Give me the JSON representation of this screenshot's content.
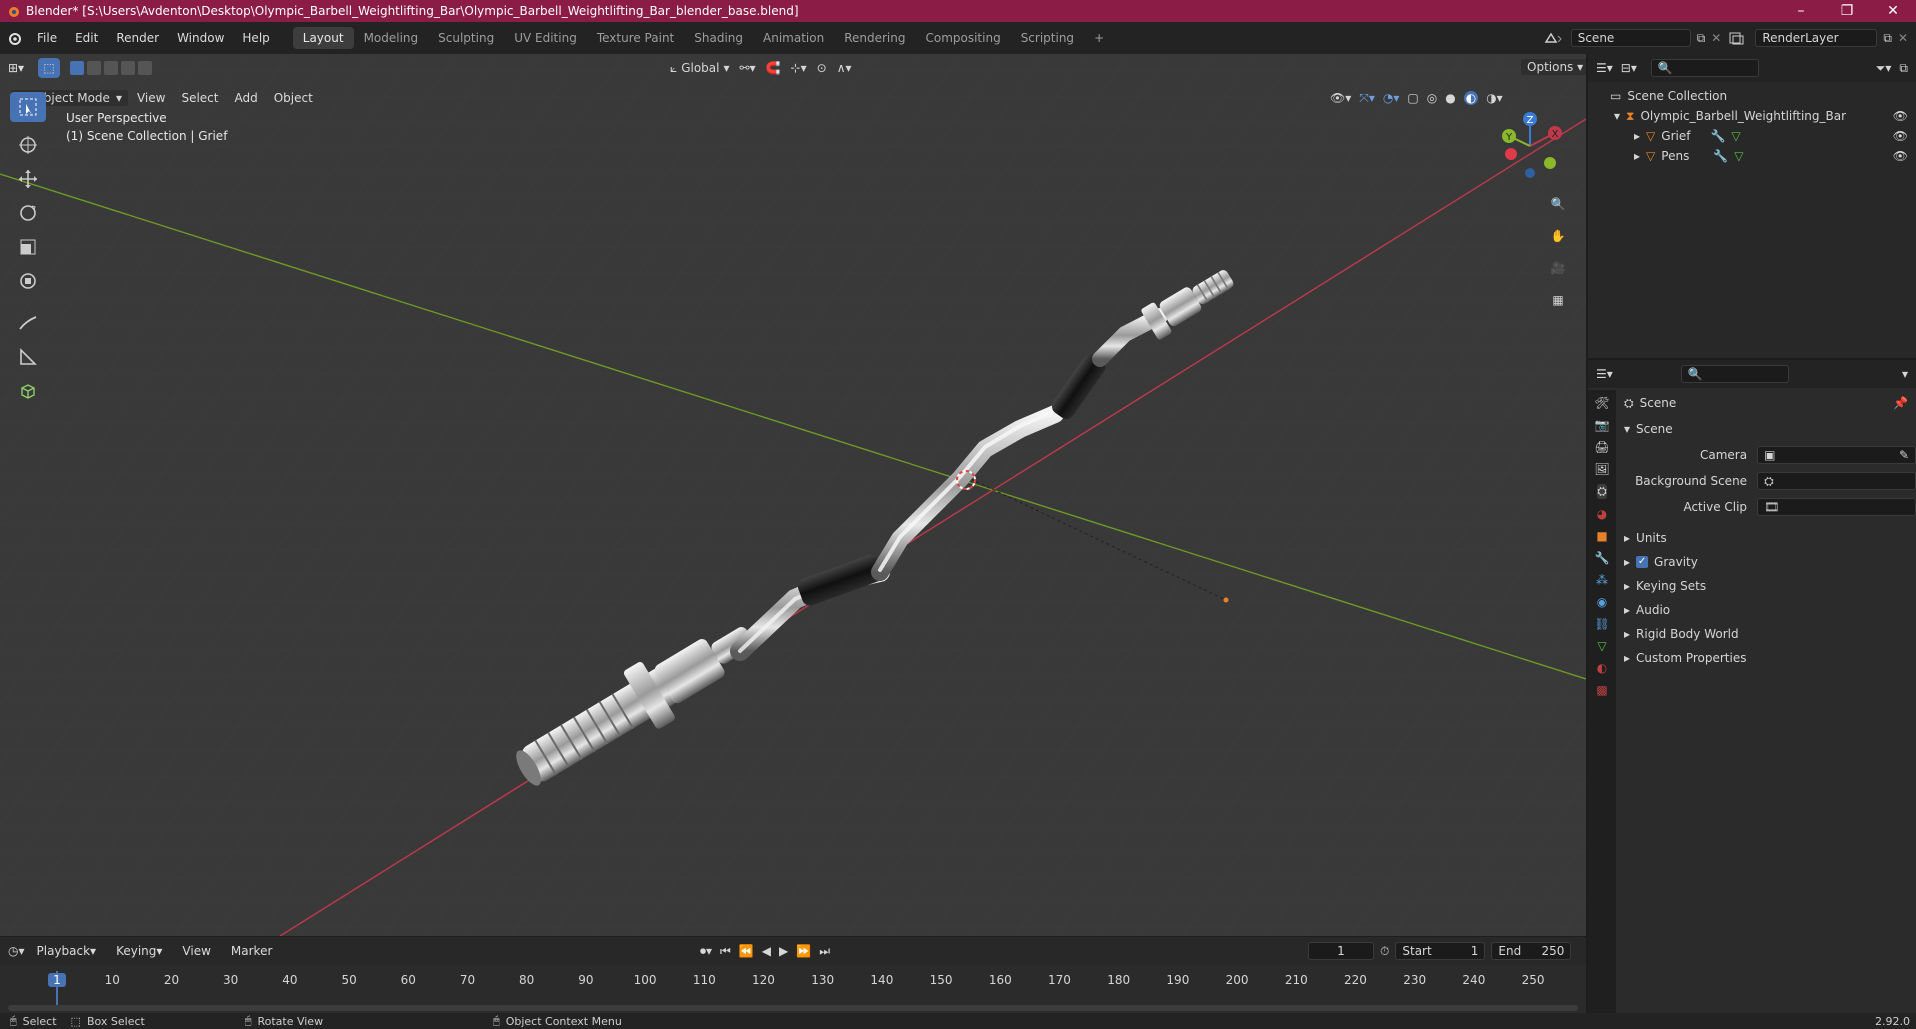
{
  "window": {
    "title": "Blender* [S:\\Users\\Avdenton\\Desktop\\Olympic_Barbell_Weightlifting_Bar\\Olympic_Barbell_Weightlifting_Bar_blender_base.blend]",
    "controls": [
      "–",
      "❐",
      "✕"
    ]
  },
  "menu": [
    "File",
    "Edit",
    "Render",
    "Window",
    "Help"
  ],
  "workspaces": [
    "Layout",
    "Modeling",
    "Sculpting",
    "UV Editing",
    "Texture Paint",
    "Shading",
    "Animation",
    "Rendering",
    "Compositing",
    "Scripting"
  ],
  "active_workspace": "Layout",
  "scene_field": "Scene",
  "renderlayer_field": "RenderLayer",
  "viewport": {
    "transform_orientation": "Global",
    "options_label": "Options",
    "mode": "Object Mode",
    "header_menus": [
      "View",
      "Select",
      "Add",
      "Object"
    ],
    "overlay_title": "User Perspective",
    "overlay_subtitle": "(1) Scene Collection | Grief",
    "gizmo_axes": {
      "z": "Z",
      "y": "Y",
      "x": "X"
    }
  },
  "outliner": {
    "root": "Scene Collection",
    "collection": "Olympic_Barbell_Weightlifting_Bar",
    "objects": [
      "Grief",
      "Pens"
    ]
  },
  "properties": {
    "context": "Scene",
    "section": "Scene",
    "fields": [
      {
        "label": "Camera",
        "value": ""
      },
      {
        "label": "Background Scene",
        "value": ""
      },
      {
        "label": "Active Clip",
        "value": ""
      }
    ],
    "panels": [
      {
        "label": "Units",
        "checkbox": false
      },
      {
        "label": "Gravity",
        "checkbox": true
      },
      {
        "label": "Keying Sets",
        "checkbox": false
      },
      {
        "label": "Audio",
        "checkbox": false
      },
      {
        "label": "Rigid Body World",
        "checkbox": false
      },
      {
        "label": "Custom Properties",
        "checkbox": false
      }
    ]
  },
  "timeline": {
    "menus": [
      "Playback",
      "Keying",
      "View",
      "Marker"
    ],
    "current_frame": "1",
    "start_label": "Start",
    "start": "1",
    "end_label": "End",
    "end": "250",
    "ruler": [
      "1",
      "10",
      "20",
      "30",
      "40",
      "50",
      "60",
      "70",
      "80",
      "90",
      "100",
      "110",
      "120",
      "130",
      "140",
      "150",
      "160",
      "170",
      "180",
      "190",
      "200",
      "210",
      "220",
      "230",
      "240",
      "250"
    ]
  },
  "statusbar": {
    "items": [
      "Select",
      "Box Select",
      "Rotate View",
      "Object Context Menu"
    ],
    "version": "2.92.0"
  },
  "colors": {
    "titlebar": "#8a1c45",
    "accent": "#4772b3",
    "x_axis": "#c0394a",
    "y_axis": "#6e9a24",
    "object_orange": "#e8822a"
  }
}
